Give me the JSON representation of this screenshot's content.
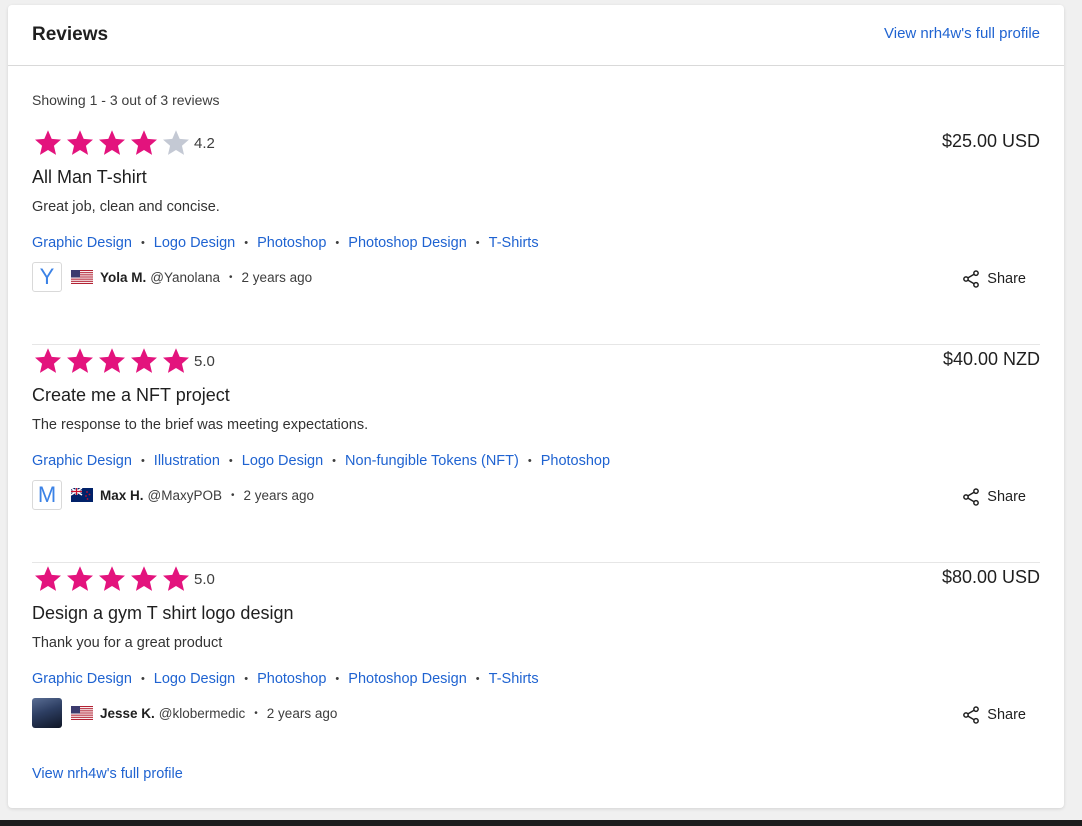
{
  "header": {
    "title": "Reviews",
    "profile_link": "View nrh4w's full profile"
  },
  "showing": "Showing 1 - 3 out of 3 reviews",
  "colors": {
    "star_filled": "#e3137d",
    "star_empty": "#c4c9d4",
    "link": "#1f63d1"
  },
  "reviews": [
    {
      "stars": 4.2,
      "rating": "4.2",
      "price": "$25.00 USD",
      "title": "All Man T-shirt",
      "text": "Great job, clean and concise.",
      "tags": [
        "Graphic Design",
        "Logo Design",
        "Photoshop",
        "Photoshop Design",
        "T-Shirts"
      ],
      "avatar_letter": "Y",
      "flag": "us-flag-icon",
      "name": "Yola M.",
      "handle": "@Yanolana",
      "time": "2 years ago",
      "share": "Share"
    },
    {
      "stars": 5,
      "rating": "5.0",
      "price": "$40.00 NZD",
      "title": "Create me a NFT project",
      "text": "The response to the brief was meeting expectations.",
      "tags": [
        "Graphic Design",
        "Illustration",
        "Logo Design",
        "Non-fungible Tokens (NFT)",
        "Photoshop"
      ],
      "avatar_letter": "M",
      "flag": "nz-flag-icon",
      "name": "Max H.",
      "handle": "@MaxyPOB",
      "time": "2 years ago",
      "share": "Share"
    },
    {
      "stars": 5,
      "rating": "5.0",
      "price": "$80.00 USD",
      "title": "Design a gym T shirt logo design",
      "text": "Thank you for a great product",
      "tags": [
        "Graphic Design",
        "Logo Design",
        "Photoshop",
        "Photoshop Design",
        "T-Shirts"
      ],
      "avatar_letter": "",
      "flag": "us-flag-icon",
      "name": "Jesse K.",
      "handle": "@klobermedic",
      "time": "2 years ago",
      "share": "Share"
    }
  ],
  "footer": {
    "profile_link": "View nrh4w's full profile"
  }
}
